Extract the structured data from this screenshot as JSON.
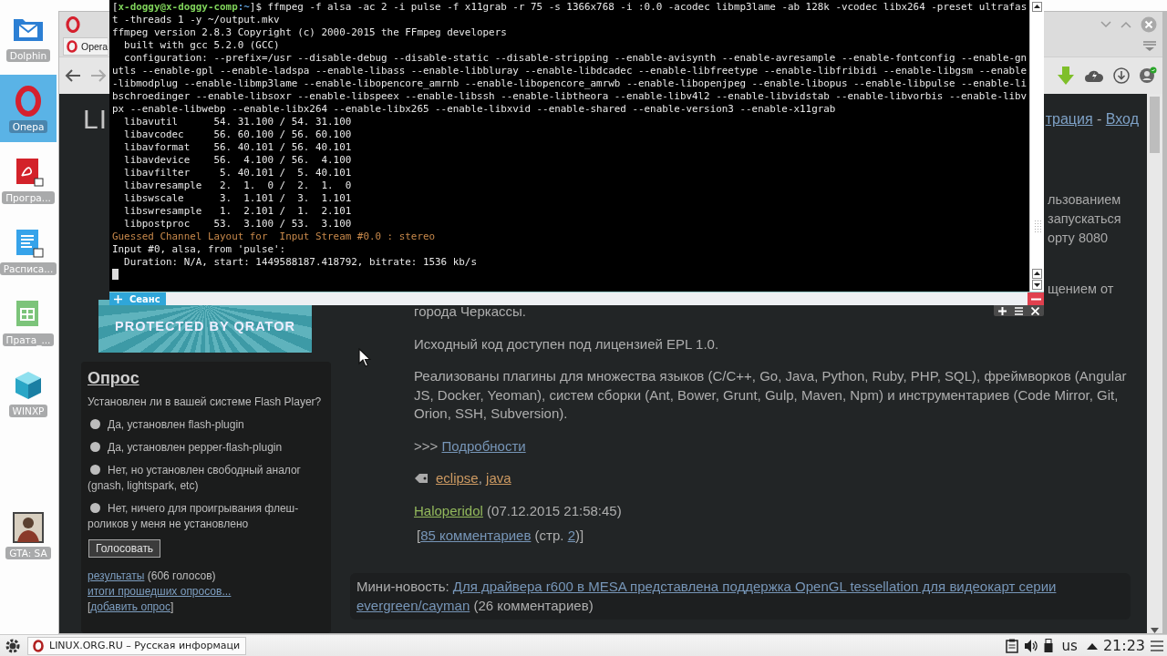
{
  "desktop_icons": [
    {
      "label": "Dolphin",
      "kind": "mail",
      "selected": false
    },
    {
      "label": "Опера",
      "kind": "opera",
      "selected": true
    },
    {
      "label": "Програ...",
      "kind": "pdf",
      "selected": false
    },
    {
      "label": "Расписа...",
      "kind": "doc",
      "selected": false
    },
    {
      "label": "Прата_...",
      "kind": "sheet",
      "selected": false
    },
    {
      "label": "WINXP",
      "kind": "cube",
      "selected": false
    },
    {
      "kind": "gap"
    },
    {
      "label": "GTA: SA",
      "kind": "photo",
      "selected": false
    }
  ],
  "browser": {
    "tab": "Opera",
    "logo": "LI",
    "header_links": [
      {
        "kind": "link",
        "text": "трация"
      },
      {
        "kind": "text",
        "text": " - "
      },
      {
        "kind": "link",
        "text": "Вход"
      }
    ],
    "fragments": [
      "льзованием",
      "запускаться",
      "орту 8080",
      "щением от"
    ],
    "banner": "PROTECTED BY QRATOR",
    "poll": {
      "title": "Опрос",
      "question": "Установлен ли в вашей системе Flash Player?",
      "options": [
        {
          "label": "Да, установлен flash-plugin",
          "selected": false
        },
        {
          "label": "Да, установлен pepper-flash-plugin",
          "selected": false
        },
        {
          "label": "Нет, но установлен свободный аналог (gnash, lightspark, etc)",
          "selected": false
        },
        {
          "label": "Нет, ничего для проигрывания флеш-роликов у меня не установлено",
          "selected": false
        }
      ],
      "button": "Голосовать",
      "footer": [
        [
          {
            "kind": "link",
            "text": "результаты"
          },
          {
            "kind": "text",
            "text": " (606 голосов)"
          }
        ],
        [
          {
            "kind": "link",
            "text": "итоги прошедших опросов..."
          }
        ],
        [
          {
            "kind": "text",
            "text": "["
          },
          {
            "kind": "link",
            "text": "добавить опрос"
          },
          {
            "kind": "text",
            "text": "]"
          }
        ]
      ]
    },
    "article": [
      {
        "kind": "text",
        "segments": [
          {
            "kind": "text",
            "text": "города Черкассы."
          }
        ]
      },
      {
        "kind": "text",
        "segments": [
          {
            "kind": "text",
            "text": "Исходный код доступен под лицензией EPL 1.0."
          }
        ]
      },
      {
        "kind": "text",
        "segments": [
          {
            "kind": "text",
            "text": "Реализованы плагины для множества языков (C/C++, Go, Java, Python, Ruby, PHP, SQL), фреймворков (Angular JS, Docker, Yeoman), систем сборки (Ant, Bower, Grunt, Gulp, Maven, Npm) и инструментариев (Code Mirror, Git, Orion, SSH, Subversion)."
          }
        ]
      },
      {
        "kind": "more",
        "segments": [
          {
            "kind": "text",
            "text": ">>> "
          },
          {
            "kind": "link",
            "text": "Подробности"
          }
        ]
      },
      {
        "kind": "tags",
        "segments": [
          {
            "kind": "tag",
            "text": "eclipse"
          },
          {
            "kind": "text",
            "text": ", "
          },
          {
            "kind": "tag",
            "text": "java"
          }
        ]
      },
      {
        "kind": "byline",
        "segments": [
          {
            "kind": "author",
            "text": "Haloperidol"
          },
          {
            "kind": "text",
            "text": " (07.12.2015 21:58:45)"
          }
        ]
      },
      {
        "kind": "comments",
        "segments": [
          {
            "kind": "text",
            "text": "["
          },
          {
            "kind": "link",
            "text": "85 комментариев"
          },
          {
            "kind": "text",
            "text": " (стр. "
          },
          {
            "kind": "link",
            "text": "2"
          },
          {
            "kind": "text",
            "text": ")]"
          }
        ]
      }
    ],
    "mini_news": [
      [
        {
          "kind": "text",
          "text": "Мини-новость: "
        },
        {
          "kind": "link",
          "text": "Для драйвера r600 в MESA представлена поддержка OpenGL tessellation для видеокарт серии"
        }
      ],
      [
        {
          "kind": "link",
          "text": "evergreen/cayman"
        },
        {
          "kind": "text",
          "text": " (26 комментариев)"
        }
      ]
    ]
  },
  "terminal": {
    "tab": "Сеанс",
    "lines": [
      {
        "kind": "prompt",
        "segments": [
          {
            "text": "["
          },
          {
            "color": "#7fd35a",
            "text": "x-doggy@x-doggy-comp"
          },
          {
            "color": "#5b9bd5",
            "text": ":~"
          },
          {
            "text": "]$ ffmpeg -f alsa -ac 2 -i pulse -f x11grab -r 75 -s 1366x768 -i :0.0 -acodec libmp3lame -ab 128k -vcodec libx264 -preset ultrafas"
          }
        ]
      },
      {
        "kind": "output",
        "text": "t -threads 1 -y ~/output.mkv"
      },
      {
        "kind": "output",
        "text": "ffmpeg version 2.8.3 Copyright (c) 2000-2015 the FFmpeg developers"
      },
      {
        "kind": "output",
        "text": "  built with gcc 5.2.0 (GCC)"
      },
      {
        "kind": "output",
        "text": "  configuration: --prefix=/usr --disable-debug --disable-static --disable-stripping --enable-avisynth --enable-avresample --enable-fontconfig --enable-gn"
      },
      {
        "kind": "output",
        "text": "utls --enable-gpl --enable-ladspa --enable-libass --enable-libbluray --enable-libdcadec --enable-libfreetype --enable-libfribidi --enable-libgsm --enable"
      },
      {
        "kind": "output",
        "text": "-libmodplug --enable-libmp3lame --enable-libopencore_amrnb --enable-libopencore_amrwb --enable-libopenjpeg --enable-libopus --enable-libpulse --enable-li"
      },
      {
        "kind": "output",
        "text": "bschroedinger --enable-libsoxr --enable-libspeex --enable-libssh --enable-libtheora --enable-libv4l2 --enable-libvidstab --enable-libvorbis --enable-libv"
      },
      {
        "kind": "output",
        "text": "px --enable-libwebp --enable-libx264 --enable-libx265 --enable-libxvid --enable-shared --enable-version3 --enable-x11grab"
      },
      {
        "kind": "output",
        "text": "  libavutil      54. 31.100 / 54. 31.100"
      },
      {
        "kind": "output",
        "text": "  libavcodec     56. 60.100 / 56. 60.100"
      },
      {
        "kind": "output",
        "text": "  libavformat    56. 40.101 / 56. 40.101"
      },
      {
        "kind": "output",
        "text": "  libavdevice    56.  4.100 / 56.  4.100"
      },
      {
        "kind": "output",
        "text": "  libavfilter     5. 40.101 /  5. 40.101"
      },
      {
        "kind": "output",
        "text": "  libavresample   2.  1.  0 /  2.  1.  0"
      },
      {
        "kind": "output",
        "text": "  libswscale      3.  1.101 /  3.  1.101"
      },
      {
        "kind": "output",
        "text": "  libswresample   1.  2.101 /  1.  2.101"
      },
      {
        "kind": "output",
        "text": "  libpostproc    53.  3.100 / 53.  3.100"
      },
      {
        "kind": "warning",
        "text": "Guessed Channel Layout for  Input Stream #0.0 : stereo"
      },
      {
        "kind": "output",
        "text": "Input #0, alsa, from 'pulse':"
      },
      {
        "kind": "output",
        "text": "  Duration: N/A, start: 1449588187.418792, bitrate: 1536 kb/s"
      },
      {
        "kind": "cursor"
      }
    ]
  },
  "taskbar": {
    "task": "LINUX.ORG.RU – Русская информаци",
    "layout": "us",
    "clock": "21:23"
  }
}
